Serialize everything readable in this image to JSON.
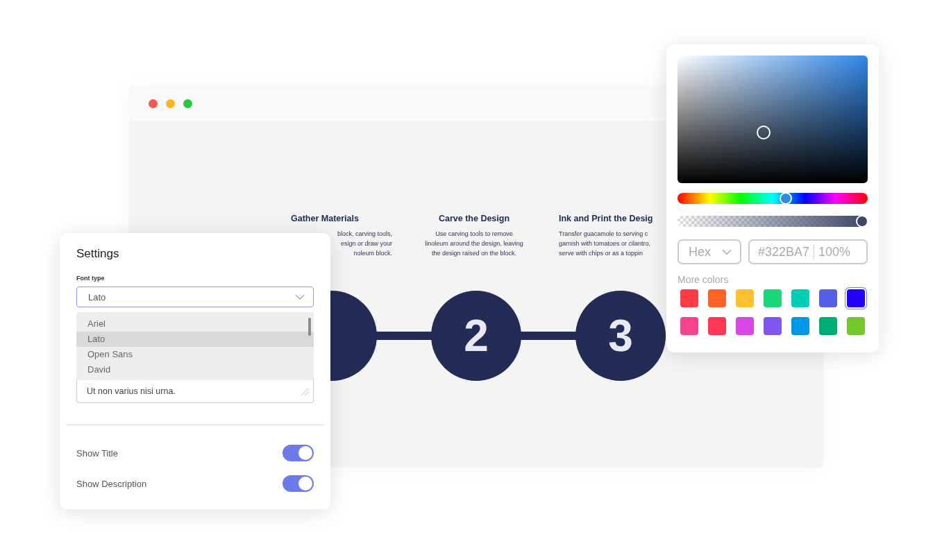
{
  "browser": {
    "dots": [
      {
        "color": "#f5584f"
      },
      {
        "color": "#f7b827"
      },
      {
        "color": "#2ac840"
      }
    ],
    "steps": [
      {
        "title": "Gather Materials",
        "description_lines": [
          "block, carving tools,",
          "esign or draw your",
          "noleum block."
        ],
        "cut_start": true,
        "cut_end": false
      },
      {
        "title": "Carve the Design",
        "description_lines": [
          "Use carving tools to remove",
          "linoleum around the design, leaving",
          "the design raised on the block."
        ],
        "number": "2",
        "cut_start": false,
        "cut_end": false
      },
      {
        "title": "Ink and Print the Desig",
        "description_lines": [
          "Transfer guacamole to serving c",
          "garnish with tomatoes or cilantro,",
          "serve with chips or as a toppin"
        ],
        "number": "3",
        "cut_start": false,
        "cut_end": true
      }
    ]
  },
  "settings": {
    "title": "Settings",
    "font_label": "Font type",
    "font_value": "Lato",
    "options": [
      {
        "label": "Ariel",
        "selected": false
      },
      {
        "label": "Lato",
        "selected": true
      },
      {
        "label": "Open Sans",
        "selected": false
      },
      {
        "label": "David",
        "selected": false
      }
    ],
    "text_value": "Ut non varius nisi urna.",
    "toggles": [
      {
        "label": "Show Title",
        "on": true
      },
      {
        "label": "Show Description",
        "on": true
      }
    ]
  },
  "color_picker": {
    "hue": {
      "level": 0.57
    },
    "alpha": {
      "level": 1
    },
    "format": "Hex",
    "hex": "#322BA7",
    "opacity": "100%",
    "more_label": "More colors",
    "swatches": [
      {
        "color": "#fd3d43",
        "selected": false
      },
      {
        "color": "#ff6327",
        "selected": false
      },
      {
        "color": "#ffc12e",
        "selected": false
      },
      {
        "color": "#1bd67a",
        "selected": false
      },
      {
        "color": "#00cdb8",
        "selected": false
      },
      {
        "color": "#5360e6",
        "selected": false
      },
      {
        "color": "#2200ff",
        "selected": true
      },
      {
        "color": "#f6448e",
        "selected": false
      },
      {
        "color": "#fe3758",
        "selected": false
      },
      {
        "color": "#d946e6",
        "selected": false
      },
      {
        "color": "#8156ee",
        "selected": false
      },
      {
        "color": "#0097e6",
        "selected": false
      },
      {
        "color": "#00ad76",
        "selected": false
      },
      {
        "color": "#74c72d",
        "selected": false
      }
    ]
  }
}
